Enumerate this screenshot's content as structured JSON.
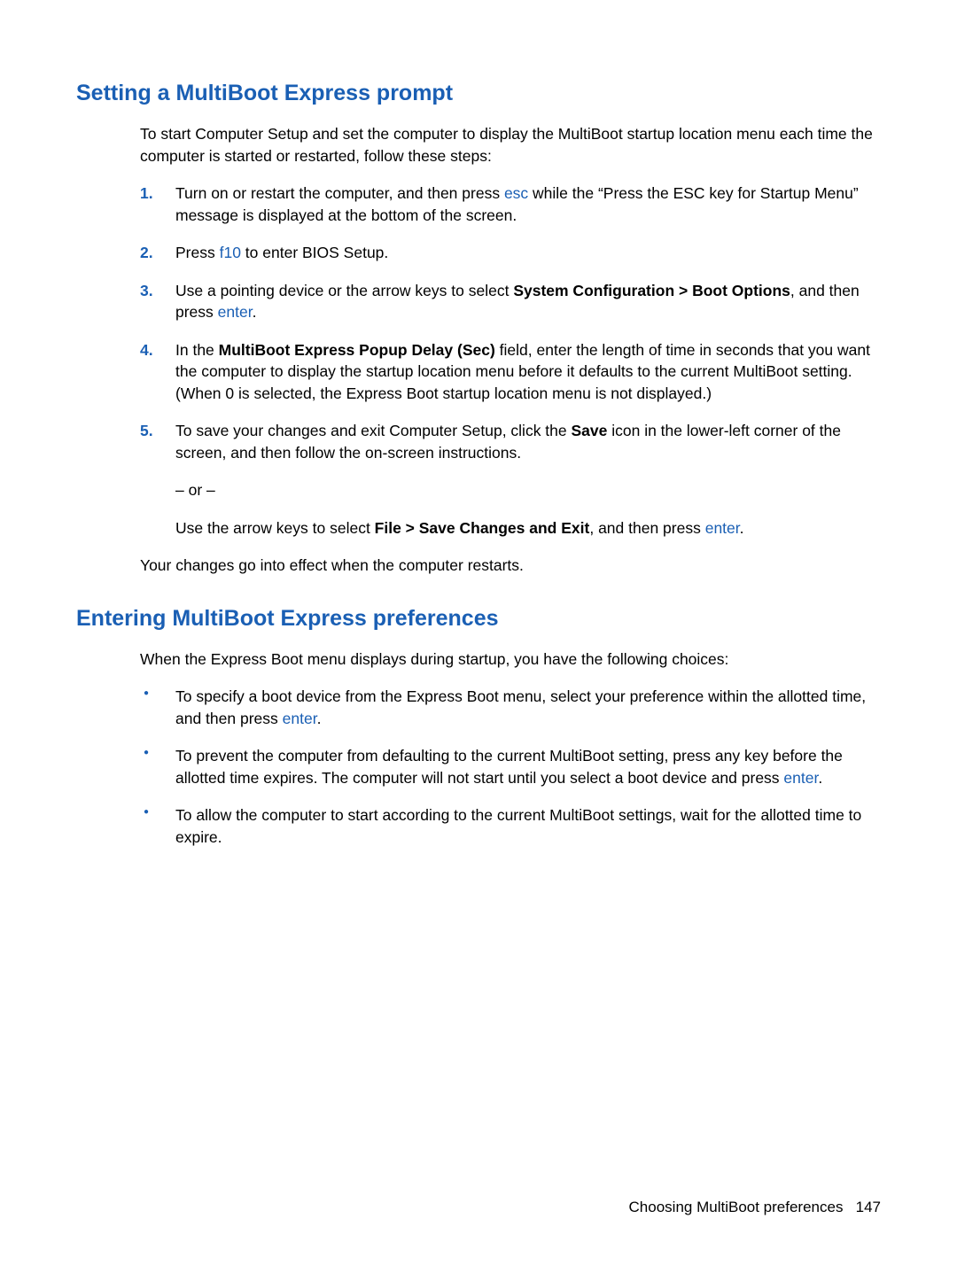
{
  "section1": {
    "heading": "Setting a MultiBoot Express prompt",
    "intro": "To start Computer Setup and set the computer to display the MultiBoot startup location menu each time the computer is started or restarted, follow these steps:",
    "steps": {
      "s1": {
        "num": "1.",
        "pre": "Turn on or restart the computer, and then press ",
        "key": "esc",
        "post": " while the “Press the ESC key for Startup Menu” message is displayed at the bottom of the screen."
      },
      "s2": {
        "num": "2.",
        "pre": "Press ",
        "key": "f10",
        "post": " to enter BIOS Setup."
      },
      "s3": {
        "num": "3.",
        "pre": "Use a pointing device or the arrow keys to select ",
        "bold": "System Configuration > Boot Options",
        "mid": ", and then press ",
        "key": "enter",
        "post": "."
      },
      "s4": {
        "num": "4.",
        "pre": "In the ",
        "bold": "MultiBoot Express Popup Delay (Sec)",
        "post": " field, enter the length of time in seconds that you want the computer to display the startup location menu before it defaults to the current MultiBoot setting. (When 0 is selected, the Express Boot startup location menu is not displayed.)"
      },
      "s5": {
        "num": "5.",
        "pre": "To save your changes and exit Computer Setup, click the ",
        "bold": "Save",
        "post": " icon in the lower-left corner of the screen, and then follow the on-screen instructions.",
        "or": "– or –",
        "alt_pre": "Use the arrow keys to select ",
        "alt_bold": "File > Save Changes and Exit",
        "alt_mid": ", and then press ",
        "alt_key": "enter",
        "alt_post": "."
      }
    },
    "closing": "Your changes go into effect when the computer restarts."
  },
  "section2": {
    "heading": "Entering MultiBoot Express preferences",
    "intro": "When the Express Boot menu displays during startup, you have the following choices:",
    "bullets": {
      "b1": {
        "pre": "To specify a boot device from the Express Boot menu, select your preference within the allotted time, and then press ",
        "key": "enter",
        "post": "."
      },
      "b2": {
        "pre": "To prevent the computer from defaulting to the current MultiBoot setting, press any key before the allotted time expires. The computer will not start until you select a boot device and press ",
        "key": "enter",
        "post": "."
      },
      "b3": {
        "text": "To allow the computer to start according to the current MultiBoot settings, wait for the allotted time to expire."
      }
    }
  },
  "footer": {
    "text": "Choosing MultiBoot preferences",
    "page": "147"
  }
}
